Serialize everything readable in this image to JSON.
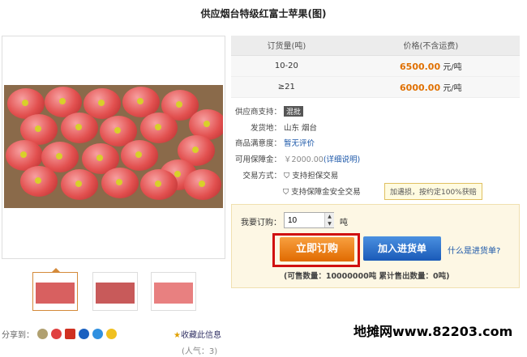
{
  "title": "供应烟台特级红富士苹果(图)",
  "price_table": {
    "headers": [
      "订货量(吨)",
      "价格(不含运费)"
    ],
    "rows": [
      {
        "qty": "10-20",
        "price": "6500.00",
        "unit": "元/吨"
      },
      {
        "qty": "≥21",
        "price": "6000.00",
        "unit": "元/吨"
      }
    ]
  },
  "info": {
    "support_label": "供应商支持：",
    "support_value": "混批",
    "ship_label": "发货地：",
    "ship_value": "山东 烟台",
    "rating_label": "商品满意度：",
    "rating_value": "暂无评价",
    "deposit_label": "可用保障金：",
    "deposit_value": "￥2000.00",
    "deposit_link": "(详细说明)",
    "trade_label": "交易方式：",
    "trade1": "支持担保交易",
    "trade2": "支持保障金安全交易",
    "tip": "加遇损，按约定100%获赔"
  },
  "order": {
    "qty_label": "我要订购：",
    "qty_value": "10",
    "qty_unit": "吨",
    "buy_label": "立即订购",
    "cart_label": "加入进货单",
    "cart_help": "什么是进货单?",
    "sold": "(可售数量：10000000吨   累计售出数量：0吨)"
  },
  "share_label": "分享到：",
  "collect_label": "收藏此信息",
  "popularity": "(人气：3)",
  "watermark": "地摊网www.82203.com",
  "colors": {
    "price": "#e07000",
    "buy": "#e06a00",
    "cart": "#1a5ab8",
    "link": "#1a56a8"
  }
}
